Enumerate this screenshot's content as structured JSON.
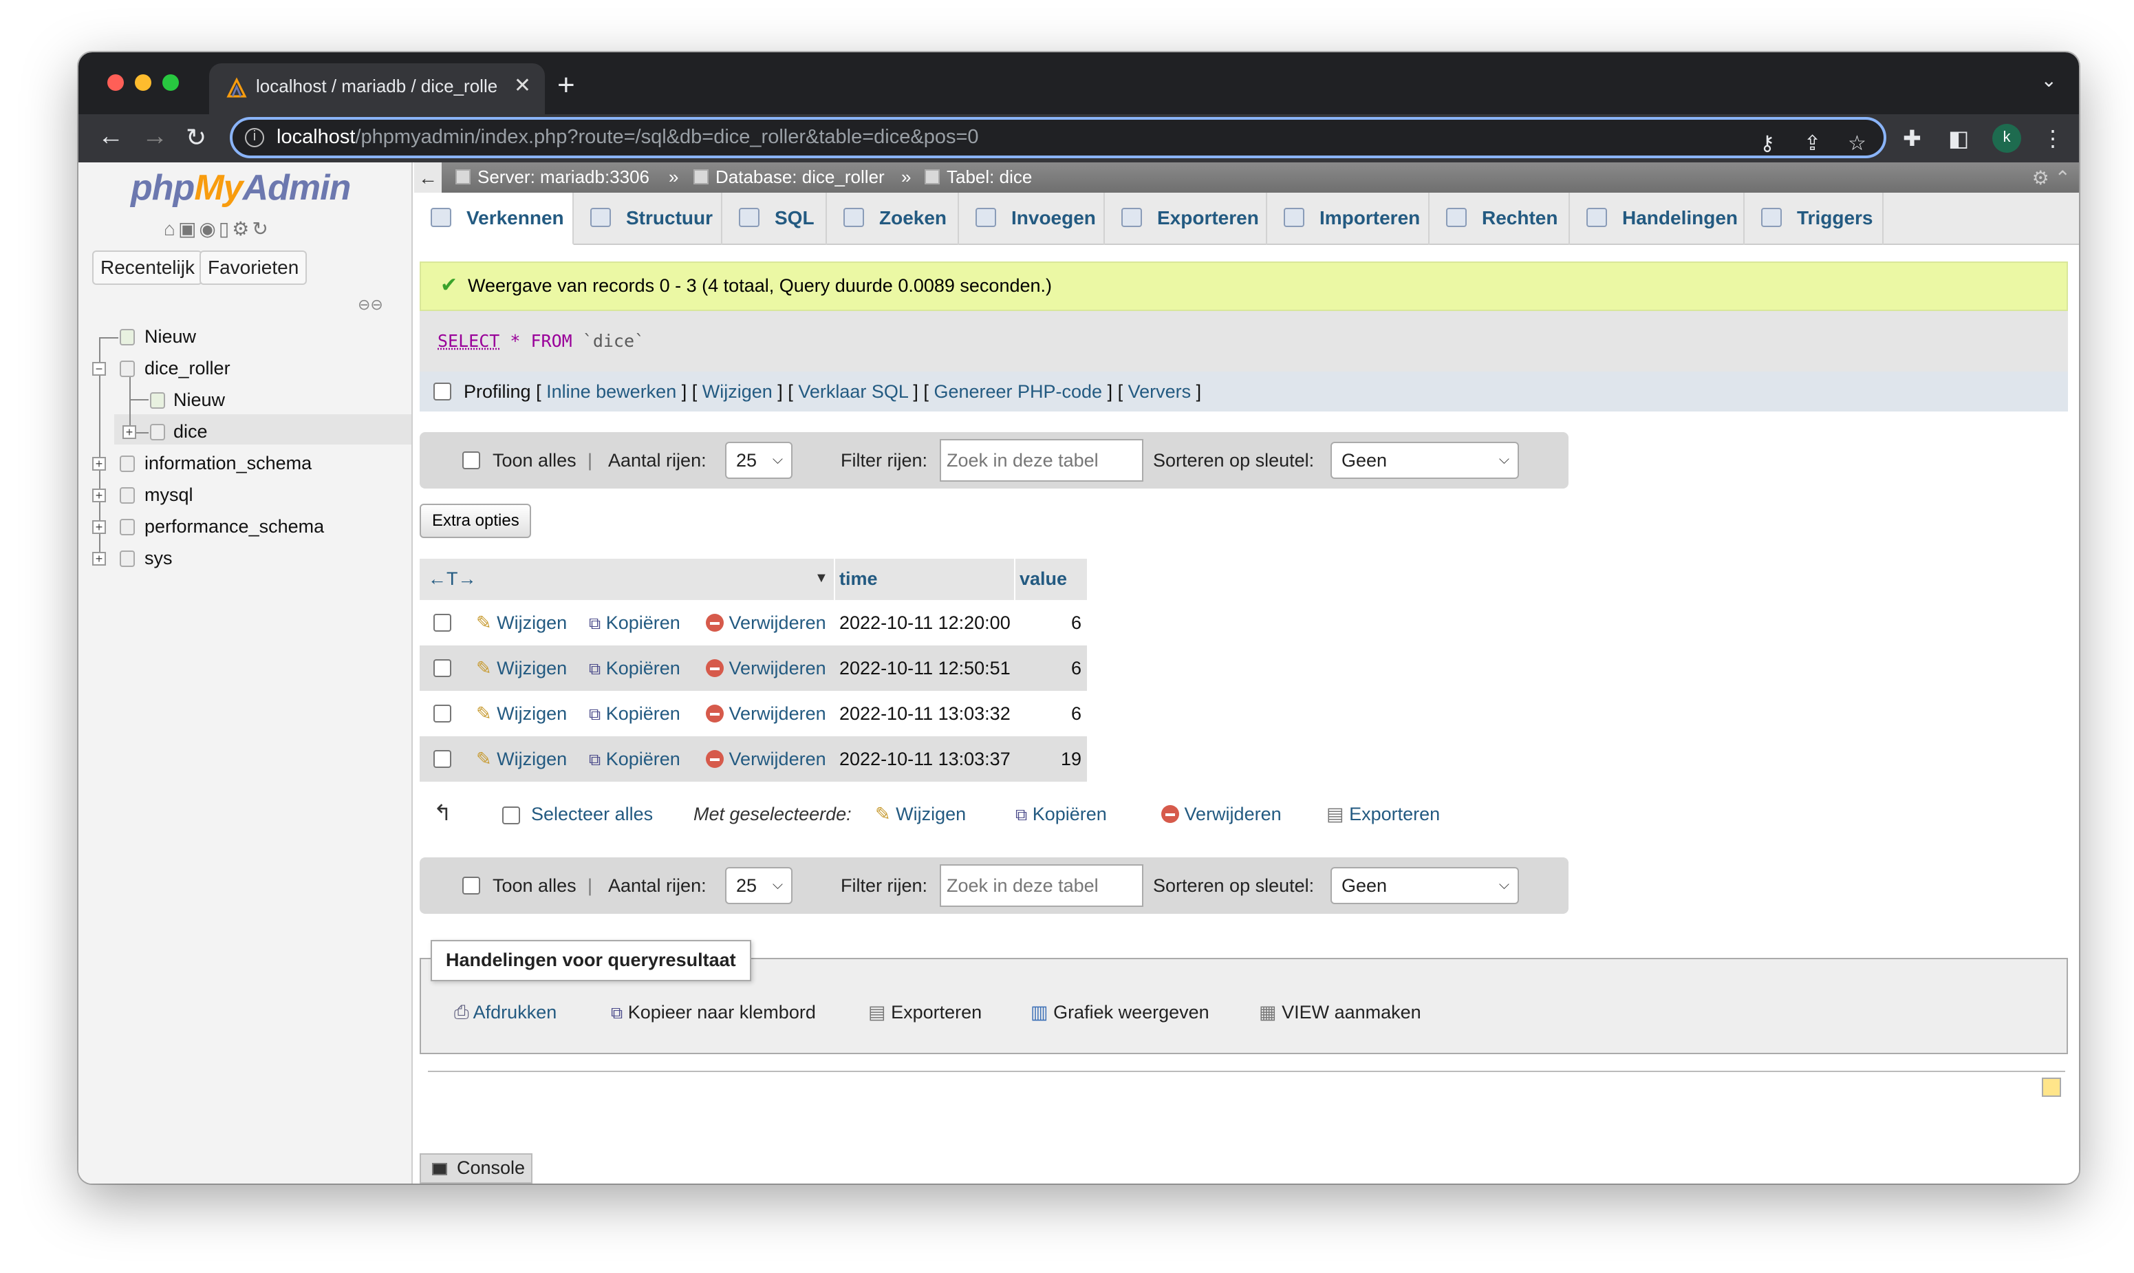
{
  "browser": {
    "tab_title": "localhost / mariadb / dice_rolle",
    "url_host": "localhost",
    "url_path": "/phpmyadmin/index.php?route=/sql&db=dice_roller&table=dice&pos=0",
    "profile_initial": "k"
  },
  "sidebar": {
    "logo_php": "php",
    "logo_my": "My",
    "logo_admin": "Admin",
    "recent_label": "Recentelijk",
    "favorites_label": "Favorieten",
    "tree": [
      {
        "label": "Nieuw"
      },
      {
        "label": "dice_roller"
      },
      {
        "label": "Nieuw"
      },
      {
        "label": "dice"
      },
      {
        "label": "information_schema"
      },
      {
        "label": "mysql"
      },
      {
        "label": "performance_schema"
      },
      {
        "label": "sys"
      }
    ]
  },
  "breadcrumb": {
    "server": "Server: mariadb:3306",
    "database": "Database: dice_roller",
    "table": "Tabel: dice",
    "sep": "»"
  },
  "tabs": [
    "Verkennen",
    "Structuur",
    "SQL",
    "Zoeken",
    "Invoegen",
    "Exporteren",
    "Importeren",
    "Rechten",
    "Handelingen",
    "Triggers"
  ],
  "success_message": "Weergave van records 0 - 3 (4 totaal, Query duurde 0.0089 seconden.)",
  "sql": {
    "select": "SELECT",
    "star": "*",
    "from": "FROM",
    "table": "`dice`"
  },
  "profiling": {
    "label": "Profiling",
    "links": [
      "Inline bewerken",
      "Wijzigen",
      "Verklaar SQL",
      "Genereer PHP-code",
      "Ververs"
    ]
  },
  "navbar": {
    "show_all": "Toon alles",
    "rows_label": "Aantal rijen:",
    "rows_value": "25",
    "filter_label": "Filter rijen:",
    "filter_placeholder": "Zoek in deze tabel",
    "sort_label": "Sorteren op sleutel:",
    "sort_value": "Geen"
  },
  "extra_options": "Extra opties",
  "table": {
    "arrows": "←T→",
    "columns": [
      "time",
      "value"
    ],
    "actions": {
      "edit": "Wijzigen",
      "copy": "Kopiëren",
      "delete": "Verwijderen"
    },
    "rows": [
      {
        "time": "2022-10-11 12:20:00",
        "value": "6"
      },
      {
        "time": "2022-10-11 12:50:51",
        "value": "6"
      },
      {
        "time": "2022-10-11 13:03:32",
        "value": "6"
      },
      {
        "time": "2022-10-11 13:03:37",
        "value": "19"
      }
    ]
  },
  "bulk": {
    "select_all": "Selecteer alles",
    "with_selected": "Met geselecteerde:",
    "edit": "Wijzigen",
    "copy": "Kopiëren",
    "delete": "Verwijderen",
    "export": "Exporteren"
  },
  "query_ops": {
    "legend": "Handelingen voor queryresultaat",
    "print": "Afdrukken",
    "copy_clipboard": "Kopieer naar klembord",
    "export": "Exporteren",
    "chart": "Grafiek weergeven",
    "view": "VIEW aanmaken"
  },
  "console_label": "Console",
  "colors": {
    "link": "#235a81",
    "success_bg": "#ebf8a4",
    "accent": "#f89c0e"
  }
}
